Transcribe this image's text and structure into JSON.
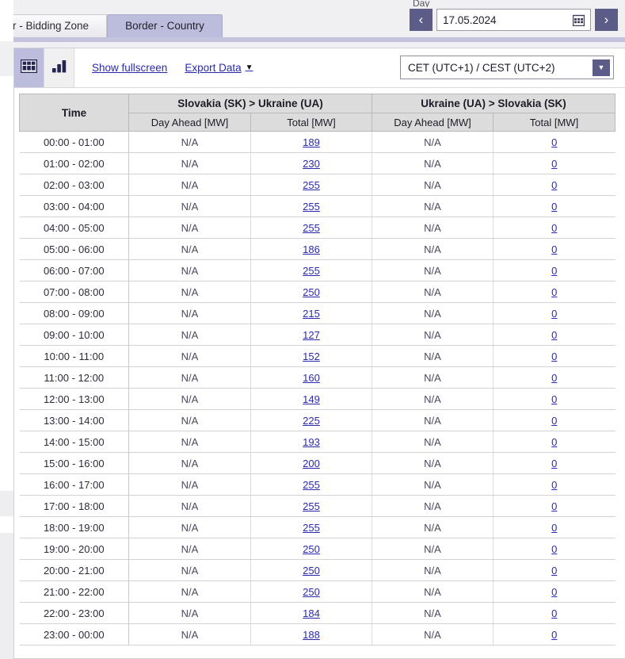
{
  "tabs": [
    {
      "label": "der - Bidding Zone",
      "active": false,
      "name": "tab-border-bidding-zone"
    },
    {
      "label": "Border - Country",
      "active": true,
      "name": "tab-border-country"
    }
  ],
  "daypicker": {
    "label": "Day",
    "prev_label": "‹",
    "next_label": "›",
    "value": "17.05.2024",
    "calendar_icon": "calendar-icon"
  },
  "toolbar": {
    "table_view_icon": "table-view-icon",
    "chart_view_icon": "bar-chart-view-icon",
    "fullscreen_label": "Show fullscreen",
    "export_label": "Export Data",
    "export_caret": "▼",
    "timezone_value": "CET (UTC+1) / CEST (UTC+2)",
    "timezone_caret": "▼"
  },
  "table": {
    "time_header": "Time",
    "groups": [
      {
        "label": "Slovakia (SK) > Ukraine (UA)"
      },
      {
        "label": "Ukraine (UA) > Slovakia (SK)"
      }
    ],
    "subheaders": [
      "Day Ahead [MW]",
      "Total [MW]",
      "Day Ahead [MW]",
      "Total [MW]"
    ],
    "rows": [
      {
        "time": "00:00 - 01:00",
        "sk_ua_da": "N/A",
        "sk_ua_total": "189",
        "ua_sk_da": "N/A",
        "ua_sk_total": "0"
      },
      {
        "time": "01:00 - 02:00",
        "sk_ua_da": "N/A",
        "sk_ua_total": "230",
        "ua_sk_da": "N/A",
        "ua_sk_total": "0"
      },
      {
        "time": "02:00 - 03:00",
        "sk_ua_da": "N/A",
        "sk_ua_total": "255",
        "ua_sk_da": "N/A",
        "ua_sk_total": "0"
      },
      {
        "time": "03:00 - 04:00",
        "sk_ua_da": "N/A",
        "sk_ua_total": "255",
        "ua_sk_da": "N/A",
        "ua_sk_total": "0"
      },
      {
        "time": "04:00 - 05:00",
        "sk_ua_da": "N/A",
        "sk_ua_total": "255",
        "ua_sk_da": "N/A",
        "ua_sk_total": "0"
      },
      {
        "time": "05:00 - 06:00",
        "sk_ua_da": "N/A",
        "sk_ua_total": "186",
        "ua_sk_da": "N/A",
        "ua_sk_total": "0"
      },
      {
        "time": "06:00 - 07:00",
        "sk_ua_da": "N/A",
        "sk_ua_total": "255",
        "ua_sk_da": "N/A",
        "ua_sk_total": "0"
      },
      {
        "time": "07:00 - 08:00",
        "sk_ua_da": "N/A",
        "sk_ua_total": "250",
        "ua_sk_da": "N/A",
        "ua_sk_total": "0"
      },
      {
        "time": "08:00 - 09:00",
        "sk_ua_da": "N/A",
        "sk_ua_total": "215",
        "ua_sk_da": "N/A",
        "ua_sk_total": "0"
      },
      {
        "time": "09:00 - 10:00",
        "sk_ua_da": "N/A",
        "sk_ua_total": "127",
        "ua_sk_da": "N/A",
        "ua_sk_total": "0"
      },
      {
        "time": "10:00 - 11:00",
        "sk_ua_da": "N/A",
        "sk_ua_total": "152",
        "ua_sk_da": "N/A",
        "ua_sk_total": "0"
      },
      {
        "time": "11:00 - 12:00",
        "sk_ua_da": "N/A",
        "sk_ua_total": "160",
        "ua_sk_da": "N/A",
        "ua_sk_total": "0"
      },
      {
        "time": "12:00 - 13:00",
        "sk_ua_da": "N/A",
        "sk_ua_total": "149",
        "ua_sk_da": "N/A",
        "ua_sk_total": "0"
      },
      {
        "time": "13:00 - 14:00",
        "sk_ua_da": "N/A",
        "sk_ua_total": "225",
        "ua_sk_da": "N/A",
        "ua_sk_total": "0"
      },
      {
        "time": "14:00 - 15:00",
        "sk_ua_da": "N/A",
        "sk_ua_total": "193",
        "ua_sk_da": "N/A",
        "ua_sk_total": "0"
      },
      {
        "time": "15:00 - 16:00",
        "sk_ua_da": "N/A",
        "sk_ua_total": "200",
        "ua_sk_da": "N/A",
        "ua_sk_total": "0"
      },
      {
        "time": "16:00 - 17:00",
        "sk_ua_da": "N/A",
        "sk_ua_total": "255",
        "ua_sk_da": "N/A",
        "ua_sk_total": "0"
      },
      {
        "time": "17:00 - 18:00",
        "sk_ua_da": "N/A",
        "sk_ua_total": "255",
        "ua_sk_da": "N/A",
        "ua_sk_total": "0"
      },
      {
        "time": "18:00 - 19:00",
        "sk_ua_da": "N/A",
        "sk_ua_total": "255",
        "ua_sk_da": "N/A",
        "ua_sk_total": "0"
      },
      {
        "time": "19:00 - 20:00",
        "sk_ua_da": "N/A",
        "sk_ua_total": "250",
        "ua_sk_da": "N/A",
        "ua_sk_total": "0"
      },
      {
        "time": "20:00 - 21:00",
        "sk_ua_da": "N/A",
        "sk_ua_total": "250",
        "ua_sk_da": "N/A",
        "ua_sk_total": "0"
      },
      {
        "time": "21:00 - 22:00",
        "sk_ua_da": "N/A",
        "sk_ua_total": "250",
        "ua_sk_da": "N/A",
        "ua_sk_total": "0"
      },
      {
        "time": "22:00 - 23:00",
        "sk_ua_da": "N/A",
        "sk_ua_total": "184",
        "ua_sk_da": "N/A",
        "ua_sk_total": "0"
      },
      {
        "time": "23:00 - 00:00",
        "sk_ua_da": "N/A",
        "sk_ua_total": "188",
        "ua_sk_da": "N/A",
        "ua_sk_total": "0"
      }
    ]
  },
  "colors": {
    "accent_purple": "#5c5c89",
    "tab_active": "#bcbcdd",
    "link_blue": "#2a2ab0",
    "header_gray": "#dcdcdc"
  }
}
